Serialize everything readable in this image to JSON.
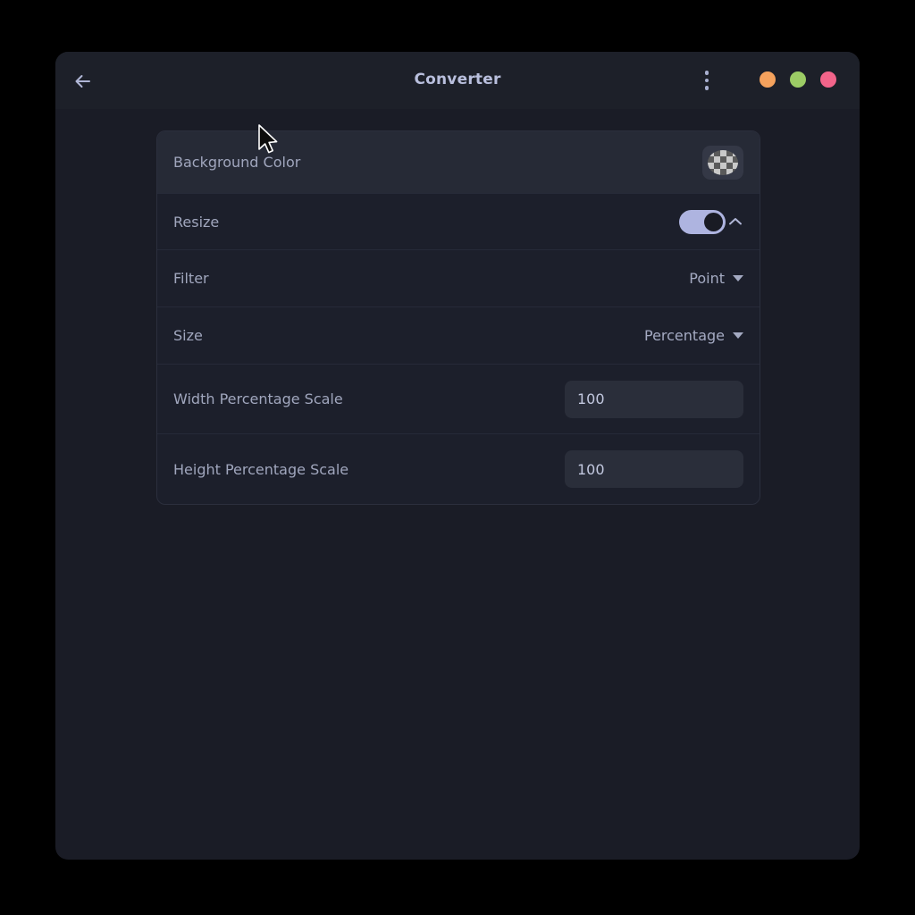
{
  "window": {
    "title": "Converter",
    "back_icon": "arrow-left-icon",
    "menu_icon": "kebab-menu-icon",
    "controls": [
      {
        "name": "minimize",
        "color": "#f5a25d"
      },
      {
        "name": "maximize",
        "color": "#9ccc65"
      },
      {
        "name": "close",
        "color": "#f2648a"
      }
    ]
  },
  "settings": {
    "background_color": {
      "label": "Background Color",
      "swatch_icon": "checkerboard-transparency-swatch"
    },
    "resize": {
      "label": "Resize",
      "toggle_state": "on",
      "expand_icon": "chevron-up-icon"
    },
    "filter": {
      "label": "Filter",
      "value": "Point",
      "caret_icon": "chevron-down-icon"
    },
    "size": {
      "label": "Size",
      "value": "Percentage",
      "caret_icon": "chevron-down-icon"
    },
    "width_scale": {
      "label": "Width Percentage Scale",
      "value": "100",
      "placeholder": "100"
    },
    "height_scale": {
      "label": "Height Percentage Scale",
      "value": "100",
      "placeholder": "100"
    }
  },
  "cursor": {
    "icon": "mouse-pointer-cursor"
  }
}
